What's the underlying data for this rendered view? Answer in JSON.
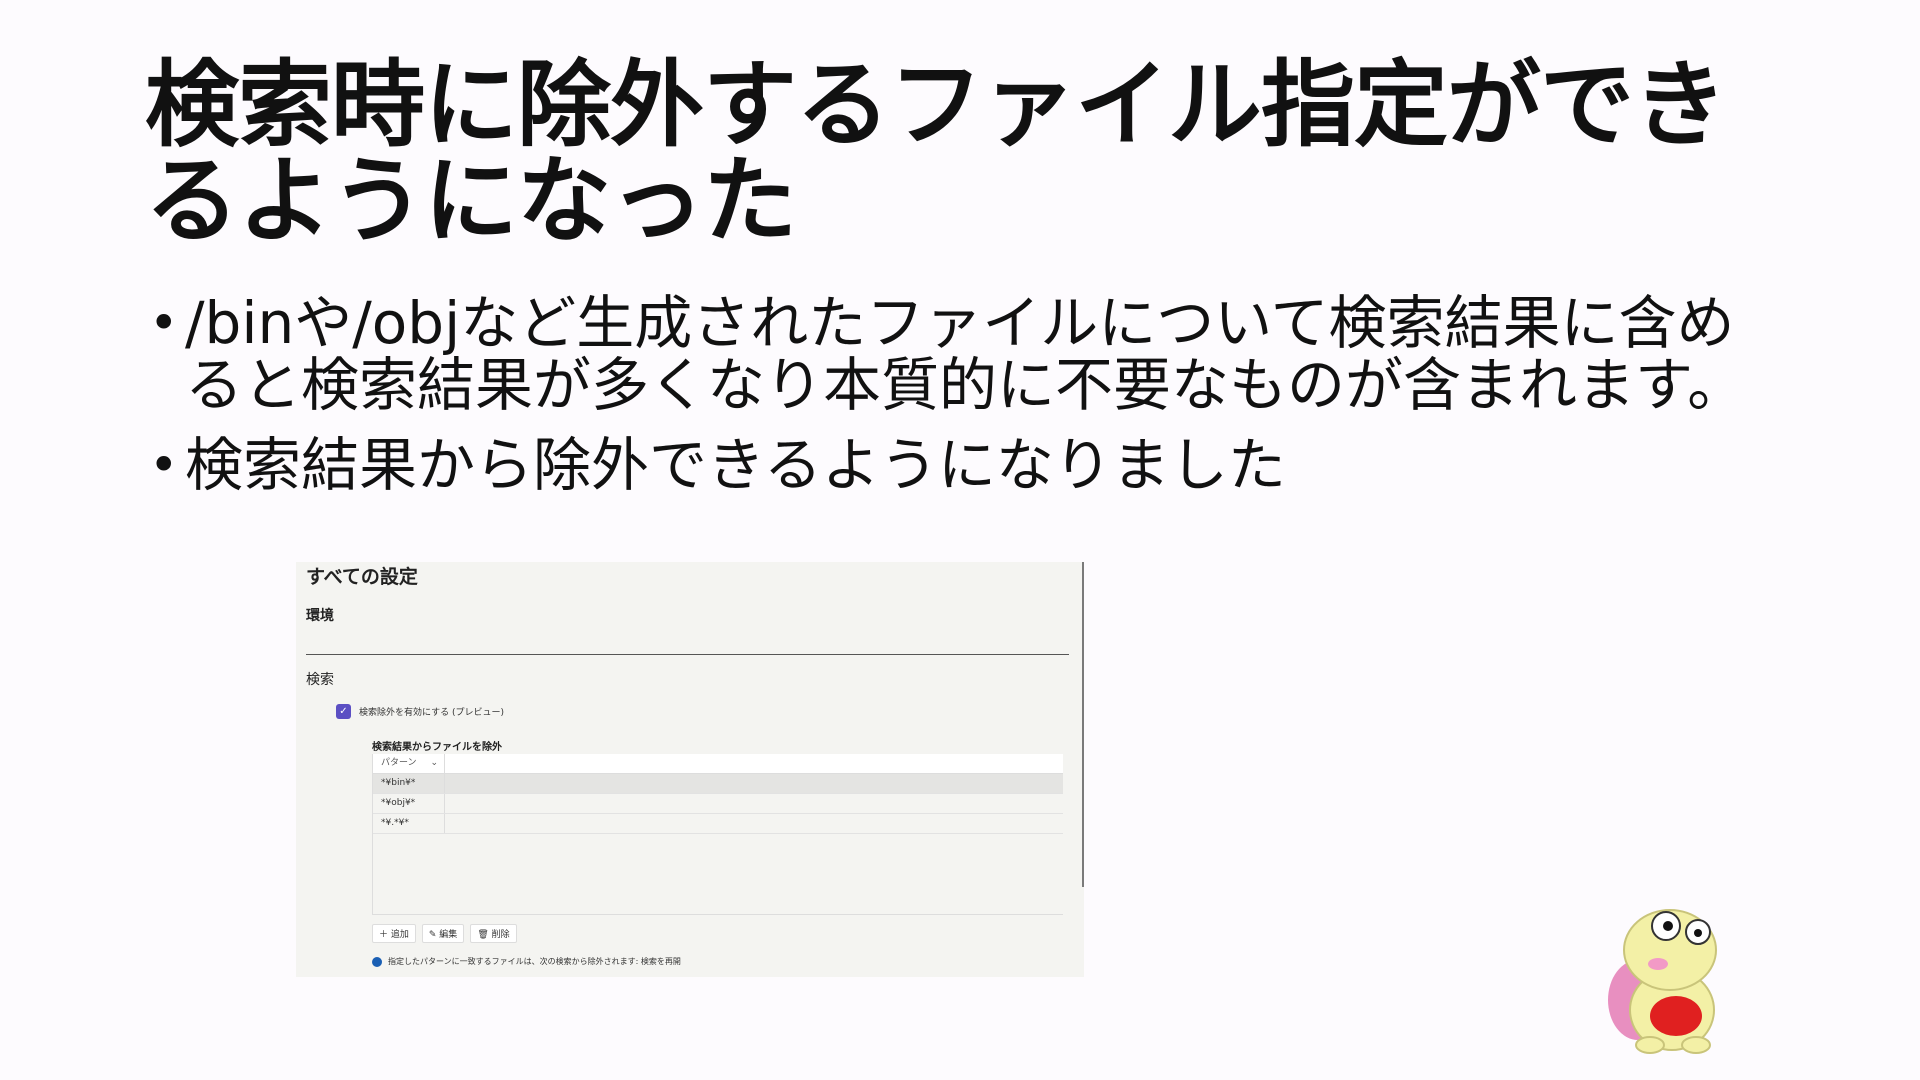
{
  "slide": {
    "title": "検索時に除外するファイル指定ができるようになった",
    "bullets": [
      "/binや/objなど生成されたファイルについて検索結果に含めると検索結果が多くなり本質的に不要なものが含まれます。",
      "検索結果から除外できるようになりました"
    ]
  },
  "settings": {
    "title": "すべての設定",
    "section_env": "環境",
    "section_search": "検索",
    "checkbox_label": "検索除外を有効にする (プレビュー)",
    "checkbox_checked": true,
    "subsection": "検索結果からファイルを除外",
    "table": {
      "header": "パターン",
      "rows": [
        "*¥bin¥*",
        "*¥obj¥*",
        "*¥.*¥*"
      ]
    },
    "toolbar": {
      "add": "追加",
      "edit": "編集",
      "delete": "削除"
    },
    "info": "指定したパターンに一致するファイルは、次の検索から除外されます: 検索を再開",
    "accent_color": "#5b4fc3"
  }
}
